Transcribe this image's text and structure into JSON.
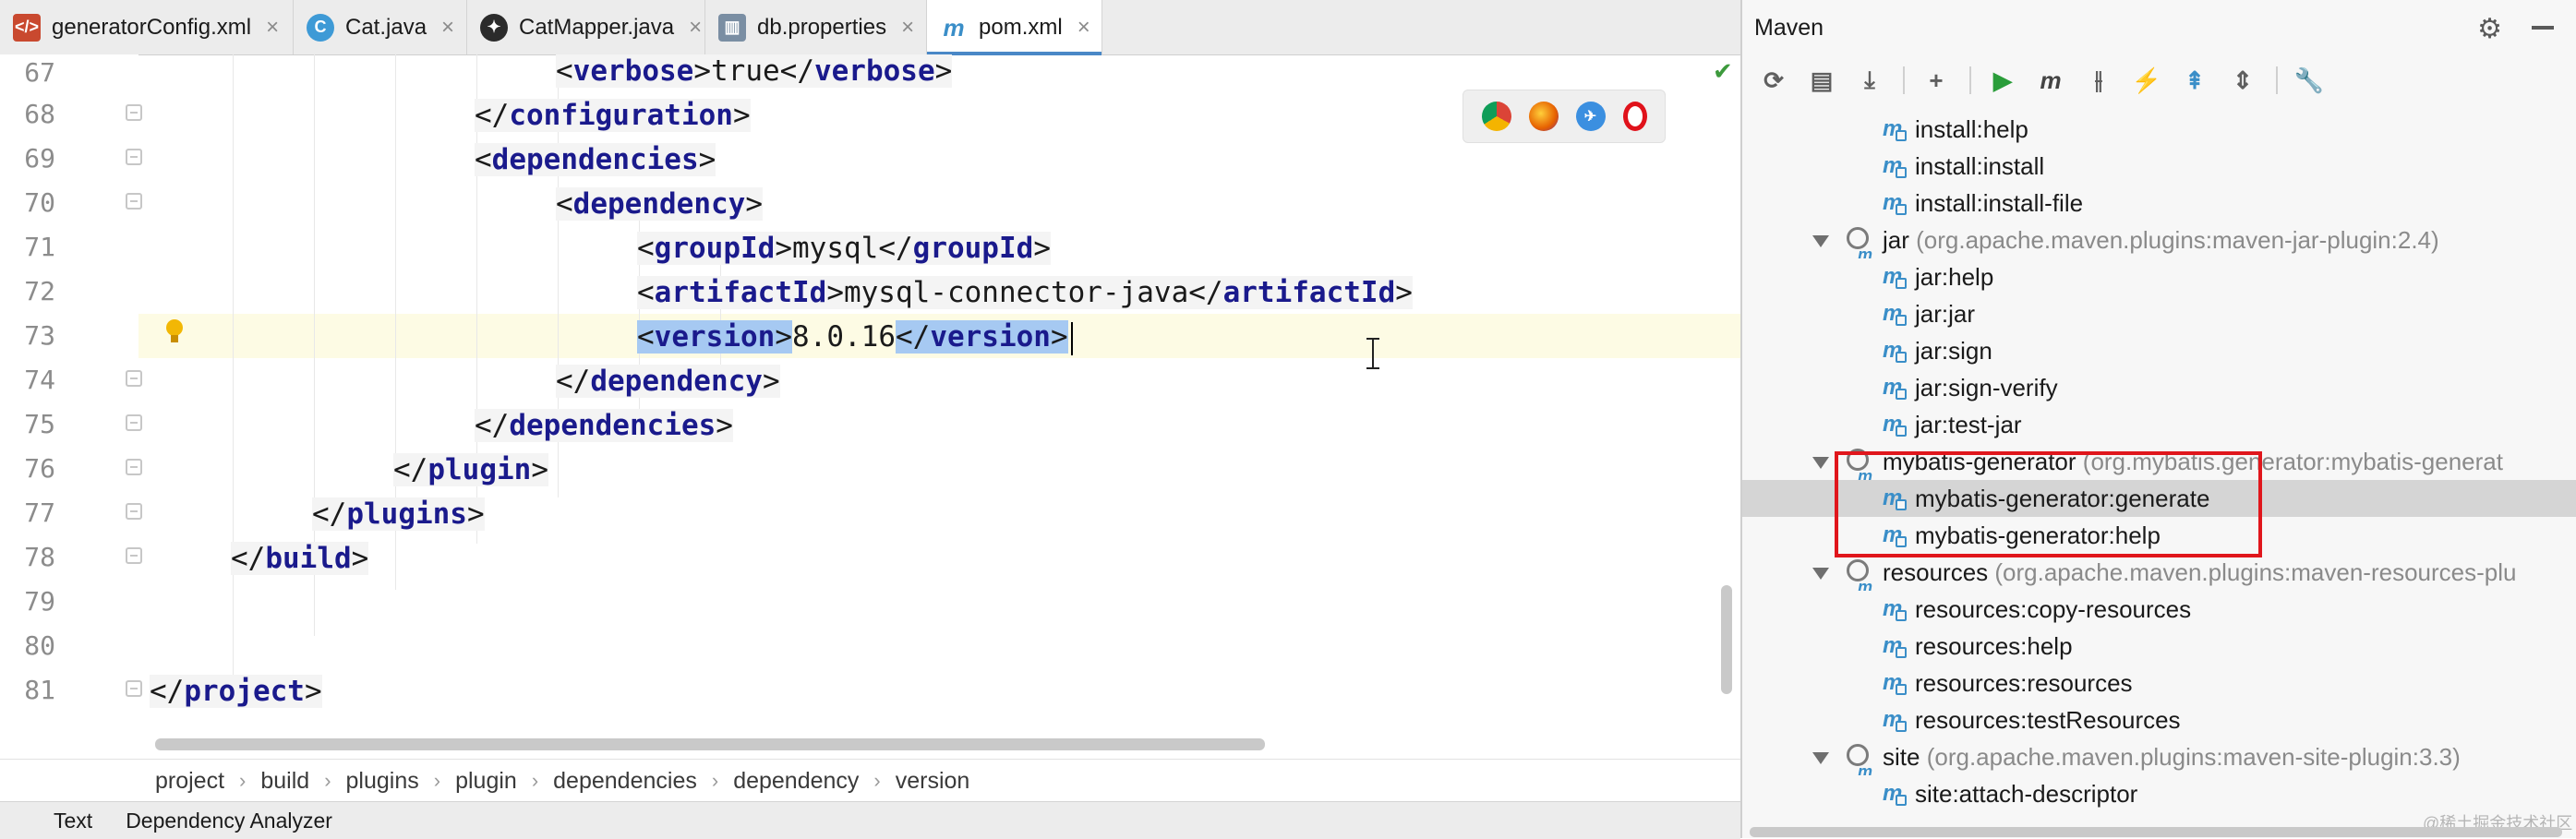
{
  "tabs": [
    {
      "label": "generatorConfig.xml",
      "icon": "xml-file-icon",
      "active": false
    },
    {
      "label": "Cat.java",
      "icon": "java-class-icon",
      "active": false
    },
    {
      "label": "CatMapper.java",
      "icon": "java-interface-icon",
      "active": false
    },
    {
      "label": "db.properties",
      "icon": "properties-file-icon",
      "active": false
    },
    {
      "label": "pom.xml",
      "icon": "maven-pom-icon",
      "active": true
    }
  ],
  "editor": {
    "line_numbers": [
      "67",
      "68",
      "69",
      "70",
      "71",
      "72",
      "73",
      "74",
      "75",
      "76",
      "77",
      "78",
      "79",
      "80",
      "81"
    ],
    "lines": {
      "l67": {
        "tag_open": "verbose",
        "text": "true",
        "tag_close": "verbose"
      },
      "l68": {
        "tag_close": "configuration"
      },
      "l69": {
        "tag_open": "dependencies"
      },
      "l70": {
        "tag_open": "dependency"
      },
      "l71": {
        "tag_open": "groupId",
        "text": "mysql",
        "tag_close": "groupId"
      },
      "l72": {
        "tag_open": "artifactId",
        "text": "mysql-connector-java",
        "tag_close": "artifactId"
      },
      "l73": {
        "tag_open": "version",
        "text": "8.0.16",
        "tag_close": "version"
      },
      "l74": {
        "tag_close": "dependency"
      },
      "l75": {
        "tag_close": "dependencies"
      },
      "l76": {
        "tag_close": "plugin"
      },
      "l77": {
        "tag_close": "plugins"
      },
      "l78": {
        "tag_close": "build"
      },
      "l81": {
        "tag_close": "project"
      }
    },
    "current_line": "73"
  },
  "browser_icons": [
    "chrome-icon",
    "firefox-icon",
    "safari-icon",
    "opera-icon"
  ],
  "breadcrumb": [
    "project",
    "build",
    "plugins",
    "plugin",
    "dependencies",
    "dependency",
    "version"
  ],
  "bottom_tabs": [
    "Text",
    "Dependency Analyzer"
  ],
  "maven": {
    "title": "Maven",
    "toolbar": [
      "reload-icon",
      "generate-sources-icon",
      "download-icon",
      "add-icon",
      "run-icon",
      "execute-goal-icon",
      "toggle-offline-icon",
      "skip-tests-icon",
      "show-dependencies-icon",
      "collapse-all-icon",
      "settings-wrench-icon"
    ],
    "tree": [
      {
        "kind": "goal",
        "label": "install:help"
      },
      {
        "kind": "goal",
        "label": "install:install"
      },
      {
        "kind": "goal",
        "label": "install:install-file"
      },
      {
        "kind": "plugin",
        "label": "jar",
        "detail": "(org.apache.maven.plugins:maven-jar-plugin:2.4)"
      },
      {
        "kind": "goal",
        "label": "jar:help"
      },
      {
        "kind": "goal",
        "label": "jar:jar"
      },
      {
        "kind": "goal",
        "label": "jar:sign"
      },
      {
        "kind": "goal",
        "label": "jar:sign-verify"
      },
      {
        "kind": "goal",
        "label": "jar:test-jar"
      },
      {
        "kind": "plugin",
        "label": "mybatis-generator",
        "detail": "(org.mybatis.generator:mybatis-generat"
      },
      {
        "kind": "goal",
        "label": "mybatis-generator:generate",
        "selected": true
      },
      {
        "kind": "goal",
        "label": "mybatis-generator:help"
      },
      {
        "kind": "plugin",
        "label": "resources",
        "detail": "(org.apache.maven.plugins:maven-resources-plu"
      },
      {
        "kind": "goal",
        "label": "resources:copy-resources"
      },
      {
        "kind": "goal",
        "label": "resources:help"
      },
      {
        "kind": "goal",
        "label": "resources:resources"
      },
      {
        "kind": "goal",
        "label": "resources:testResources"
      },
      {
        "kind": "plugin",
        "label": "site",
        "detail": "(org.apache.maven.plugins:maven-site-plugin:3.3)"
      },
      {
        "kind": "goal",
        "label": "site:attach-descriptor"
      }
    ]
  },
  "watermark": "@稀土掘金技术社区",
  "colors": {
    "selection": "#a6c9f2",
    "current_line": "#fdfbe4",
    "annotation_box": "#e0161c",
    "tag": "#1a1a8c",
    "accent": "#4a88c7"
  }
}
